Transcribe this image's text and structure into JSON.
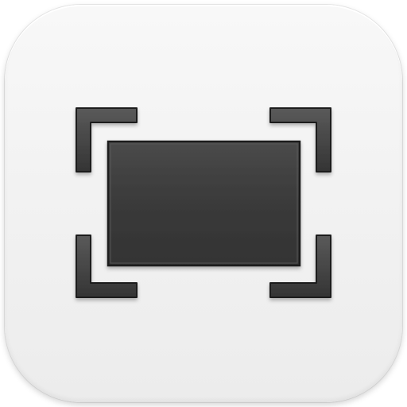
{
  "icon": {
    "name": "screenshot-frame-icon",
    "background_color": "#f2f2f2",
    "glyph_color": "#3c3c3c",
    "glyph_edge_color": "#1e1e1e"
  }
}
